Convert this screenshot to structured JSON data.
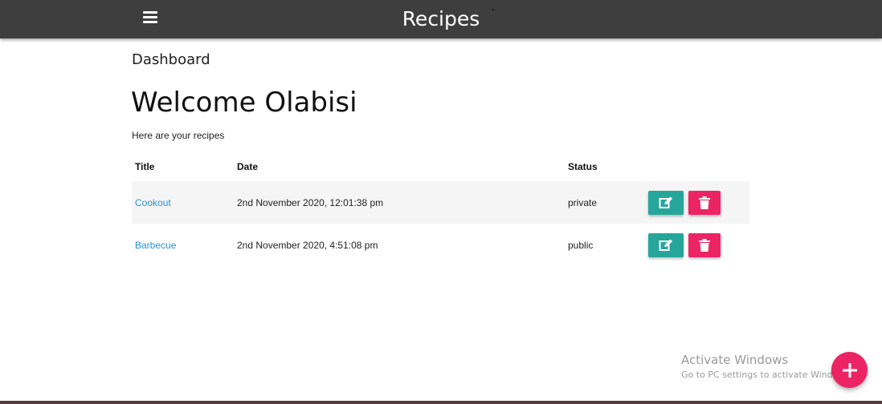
{
  "navbar": {
    "title": "Recipes",
    "menu_icon": "hamburger-menu-icon",
    "background": "#3e3e3e"
  },
  "breadcrumb": "Dashboard",
  "welcome": "Welcome Olabisi",
  "subtitle": "Here are your recipes",
  "table": {
    "headers": {
      "title": "Title",
      "date": "Date",
      "status": "Status"
    },
    "rows": [
      {
        "title": "Cookout",
        "date": "2nd November 2020, 12:01:38 pm",
        "status": "private"
      },
      {
        "title": "Barbecue",
        "date": "2nd November 2020, 4:51:08 pm",
        "status": "public"
      }
    ],
    "edit_icon": "edit-icon",
    "delete_icon": "trash-icon"
  },
  "colors": {
    "edit": "#26a69a",
    "delete": "#ec2465",
    "link": "#2a93d5",
    "fab": "#ec2465"
  },
  "watermark": {
    "title": "Activate Windows",
    "subtitle": "Go to PC settings to activate Windows."
  },
  "fab_icon": "plus-icon"
}
